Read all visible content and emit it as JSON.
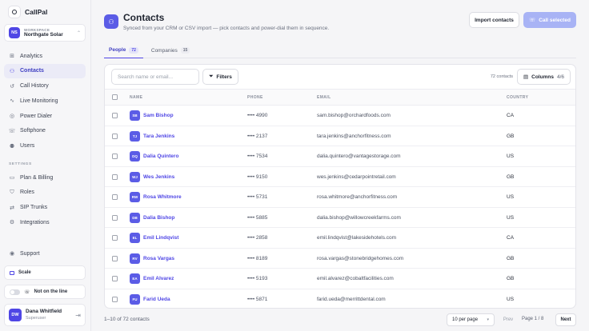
{
  "brand": {
    "name": "CallPal"
  },
  "workspace": {
    "label": "WORKSPACE",
    "initials": "NS",
    "name": "Northgate Solar"
  },
  "nav": {
    "main": [
      {
        "label": "Analytics",
        "icon": "chart-icon",
        "glyph": "⊞"
      },
      {
        "label": "Contacts",
        "icon": "contacts-icon",
        "glyph": "⚇"
      },
      {
        "label": "Call History",
        "icon": "history-icon",
        "glyph": "↺"
      },
      {
        "label": "Live Monitoring",
        "icon": "pulse-icon",
        "glyph": "∿"
      },
      {
        "label": "Power Dialer",
        "icon": "dialer-icon",
        "glyph": "◎"
      },
      {
        "label": "Softphone",
        "icon": "phone-icon",
        "glyph": "☏"
      },
      {
        "label": "Users",
        "icon": "users-icon",
        "glyph": "⚉"
      }
    ],
    "settings_label": "SETTINGS",
    "settings": [
      {
        "label": "Plan & Billing",
        "icon": "card-icon",
        "glyph": "▭"
      },
      {
        "label": "Roles",
        "icon": "shield-icon",
        "glyph": "⛉"
      },
      {
        "label": "SIP Trunks",
        "icon": "trunk-icon",
        "glyph": "⇄"
      },
      {
        "label": "Integrations",
        "icon": "integrations-icon",
        "glyph": "⚙"
      }
    ],
    "support": {
      "label": "Support",
      "icon": "support-icon",
      "glyph": "◉"
    }
  },
  "plan": {
    "label": "Scale"
  },
  "status": {
    "label": "Not on the line",
    "glyph": "☏"
  },
  "user": {
    "initials": "DW",
    "name": "Dana Whitfield",
    "role": "Superuser"
  },
  "header": {
    "title": "Contacts",
    "subtitle": "Synced from your CRM or CSV import — pick contacts and power-dial them in sequence.",
    "import_label": "Import contacts",
    "call_label": "Call selected"
  },
  "tabs": [
    {
      "label": "People",
      "count": "72"
    },
    {
      "label": "Companies",
      "count": "15"
    }
  ],
  "toolbar": {
    "search_placeholder": "Search name or email...",
    "filters_label": "Filters",
    "count_text": "72 contacts",
    "columns_label": "Columns",
    "columns_fraction": "4/6"
  },
  "table": {
    "headers": {
      "name": "NAME",
      "phone": "PHONE",
      "email": "EMAIL",
      "country": "COUNTRY"
    },
    "rows": [
      {
        "initials": "SB",
        "name": "Sam Bishop",
        "phone": "•••• 4990",
        "email": "sam.bishop@orchardfoods.com",
        "country": "CA"
      },
      {
        "initials": "TJ",
        "name": "Tara Jenkins",
        "phone": "•••• 2137",
        "email": "tara.jenkins@anchorfitness.com",
        "country": "GB"
      },
      {
        "initials": "DQ",
        "name": "Dalia Quintero",
        "phone": "•••• 7534",
        "email": "dalia.quintero@vantagestorage.com",
        "country": "US"
      },
      {
        "initials": "WJ",
        "name": "Wes Jenkins",
        "phone": "•••• 9150",
        "email": "wes.jenkins@cedarpointretail.com",
        "country": "GB"
      },
      {
        "initials": "RW",
        "name": "Rosa Whitmore",
        "phone": "•••• 5731",
        "email": "rosa.whitmore@anchorfitness.com",
        "country": "US"
      },
      {
        "initials": "DB",
        "name": "Dalia Bishop",
        "phone": "•••• 5885",
        "email": "dalia.bishop@willowcreekfarms.com",
        "country": "US"
      },
      {
        "initials": "EL",
        "name": "Emil Lindqvist",
        "phone": "•••• 2858",
        "email": "emil.lindqvist@lakesidehotels.com",
        "country": "CA"
      },
      {
        "initials": "RV",
        "name": "Rosa Vargas",
        "phone": "•••• 8189",
        "email": "rosa.vargas@stonebridgehomes.com",
        "country": "GB"
      },
      {
        "initials": "EA",
        "name": "Emil Alvarez",
        "phone": "•••• 5193",
        "email": "emil.alvarez@cobaltfacilities.com",
        "country": "GB"
      },
      {
        "initials": "FU",
        "name": "Farid Ueda",
        "phone": "•••• 5871",
        "email": "farid.ueda@merrittdental.com",
        "country": "US"
      }
    ]
  },
  "footer": {
    "count_text": "1–10 of 72 contacts",
    "per_page": "10 per page",
    "prev_label": "Prev",
    "page_info": "Page 1 / 8",
    "next_label": "Next"
  },
  "colors": {
    "accent": "#4f46e5",
    "call_button": "#a8b3f5"
  }
}
